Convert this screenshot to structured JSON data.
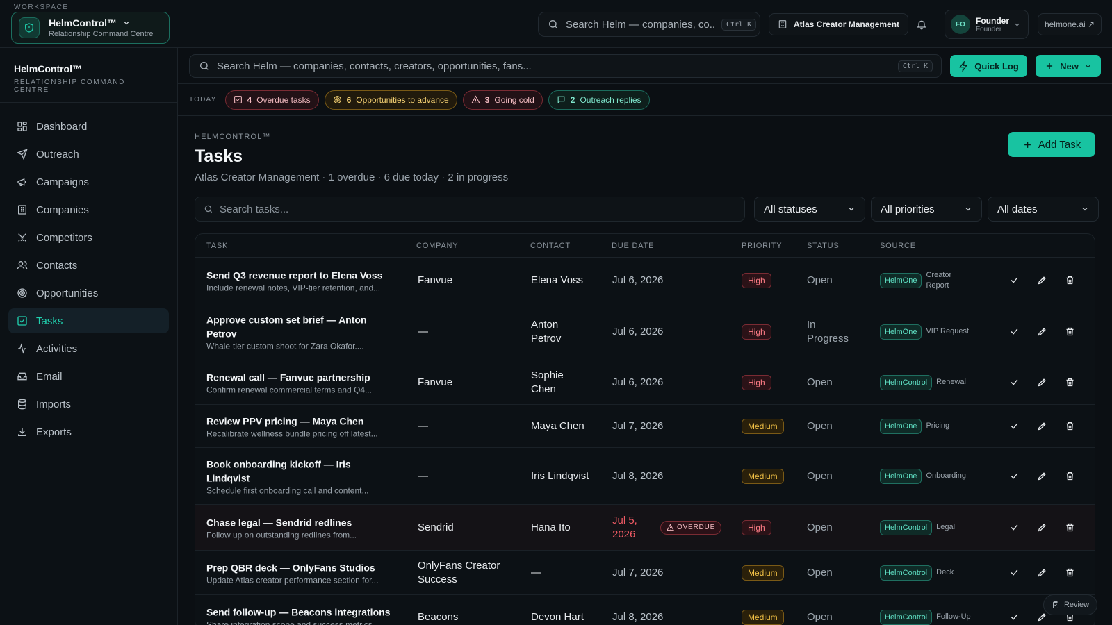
{
  "workspace": {
    "label": "WORKSPACE",
    "name": "HelmControl™",
    "subtitle": "Relationship Command Centre"
  },
  "topbar": {
    "search_placeholder": "Search Helm — companies, co...",
    "search_shortcut": "Ctrl K",
    "org_name": "Atlas Creator Management",
    "user_initials": "FO",
    "user_name": "Founder",
    "user_role": "Founder",
    "external_link": "helmone.ai ↗"
  },
  "sidebar": {
    "brand_name": "HelmControl™",
    "brand_sub": "RELATIONSHIP COMMAND CENTRE",
    "items": [
      {
        "label": "Dashboard",
        "icon": "dashboard-icon"
      },
      {
        "label": "Outreach",
        "icon": "send-icon"
      },
      {
        "label": "Campaigns",
        "icon": "megaphone-icon"
      },
      {
        "label": "Companies",
        "icon": "building-icon"
      },
      {
        "label": "Competitors",
        "icon": "swords-icon"
      },
      {
        "label": "Contacts",
        "icon": "users-icon"
      },
      {
        "label": "Opportunities",
        "icon": "target-icon"
      },
      {
        "label": "Tasks",
        "icon": "checkbox-icon",
        "active": true
      },
      {
        "label": "Activities",
        "icon": "activity-icon"
      },
      {
        "label": "Email",
        "icon": "inbox-icon"
      },
      {
        "label": "Imports",
        "icon": "database-icon"
      },
      {
        "label": "Exports",
        "icon": "download-icon"
      }
    ]
  },
  "command": {
    "placeholder": "Search Helm — companies, contacts, creators, opportunities, fans...",
    "shortcut": "Ctrl K",
    "quick_log": "Quick Log",
    "new_label": "New"
  },
  "today": {
    "label": "TODAY",
    "chips": [
      {
        "count": "4",
        "label": "Overdue tasks",
        "tone": "red"
      },
      {
        "count": "6",
        "label": "Opportunities to advance",
        "tone": "amber"
      },
      {
        "count": "3",
        "label": "Going cold",
        "tone": "red"
      },
      {
        "count": "2",
        "label": "Outreach replies",
        "tone": "green"
      }
    ]
  },
  "page": {
    "kicker": "HELMCONTROL™",
    "title": "Tasks",
    "subtitle": "Atlas Creator Management · 1 overdue · 6 due today · 2 in progress",
    "add_task": "Add Task"
  },
  "filters": {
    "search_placeholder": "Search tasks...",
    "status": "All statuses",
    "priority": "All priorities",
    "dates": "All dates"
  },
  "table": {
    "headers": {
      "task": "TASK",
      "company": "COMPANY",
      "contact": "CONTACT",
      "due": "DUE DATE",
      "priority": "PRIORITY",
      "status": "STATUS",
      "source": "SOURCE"
    },
    "rows": [
      {
        "title": "Send Q3 revenue report to Elena Voss",
        "desc": "Include renewal notes, VIP-tier retention, and...",
        "company": "Fanvue",
        "contact": "Elena Voss",
        "due": "Jul 6, 2026",
        "priority": "High",
        "status": "Open",
        "source": "HelmOne",
        "source_note": "Creator Report"
      },
      {
        "title": "Approve custom set brief — Anton Petrov",
        "desc": "Whale-tier custom shoot for Zara Okafor....",
        "company": "—",
        "contact": "Anton Petrov",
        "due": "Jul 6, 2026",
        "priority": "High",
        "status": "In Progress",
        "source": "HelmOne",
        "source_note": "VIP Request"
      },
      {
        "title": "Renewal call — Fanvue partnership",
        "desc": "Confirm renewal commercial terms and Q4...",
        "company": "Fanvue",
        "contact": "Sophie Chen",
        "due": "Jul 6, 2026",
        "priority": "High",
        "status": "Open",
        "source": "HelmControl",
        "source_note": "Renewal"
      },
      {
        "title": "Review PPV pricing — Maya Chen",
        "desc": "Recalibrate wellness bundle pricing off latest...",
        "company": "—",
        "contact": "Maya Chen",
        "due": "Jul 7, 2026",
        "priority": "Medium",
        "status": "Open",
        "source": "HelmOne",
        "source_note": "Pricing"
      },
      {
        "title": "Book onboarding kickoff — Iris Lindqvist",
        "desc": "Schedule first onboarding call and content...",
        "company": "—",
        "contact": "Iris Lindqvist",
        "due": "Jul 8, 2026",
        "priority": "Medium",
        "status": "Open",
        "source": "HelmOne",
        "source_note": "Onboarding"
      },
      {
        "title": "Chase legal — Sendrid redlines",
        "desc": "Follow up on outstanding redlines from...",
        "company": "Sendrid",
        "contact": "Hana Ito",
        "due": "Jul 5, 2026",
        "overdue": "OVERDUE",
        "priority": "High",
        "status": "Open",
        "source": "HelmControl",
        "source_note": "Legal"
      },
      {
        "title": "Prep QBR deck — OnlyFans Studios",
        "desc": "Update Atlas creator performance section for...",
        "company": "OnlyFans Creator Success",
        "contact": "—",
        "due": "Jul 7, 2026",
        "priority": "Medium",
        "status": "Open",
        "source": "HelmControl",
        "source_note": "Deck"
      },
      {
        "title": "Send follow-up — Beacons integrations",
        "desc": "Share integration scope and success metrics...",
        "company": "Beacons",
        "contact": "Devon Hart",
        "due": "Jul 8, 2026",
        "priority": "Medium",
        "status": "Open",
        "source": "HelmControl",
        "source_note": "Follow-Up"
      }
    ]
  },
  "review_label": "Review",
  "colors": {
    "accent": "#18c3a1",
    "danger": "#ef5a64",
    "warning": "#f3c246",
    "background": "#0b0f13"
  }
}
